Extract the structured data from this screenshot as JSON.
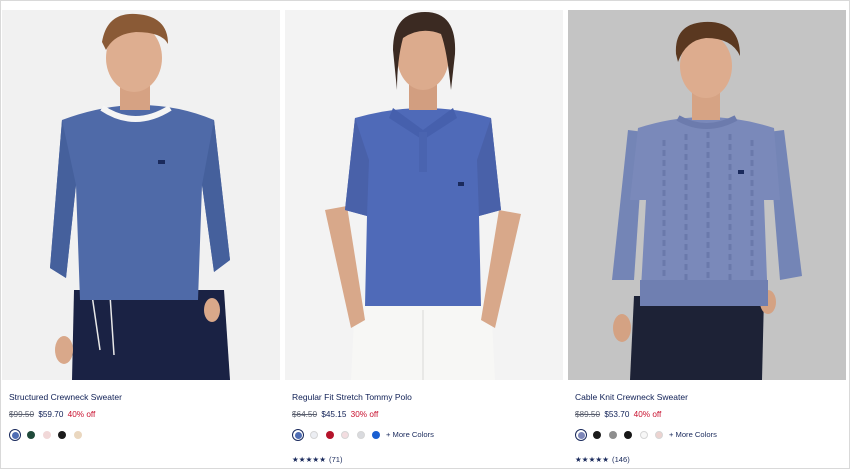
{
  "products": [
    {
      "title": "Structured Crewneck Sweater",
      "original_price": "$99.50",
      "sale_price": "$59.70",
      "discount": "40% off",
      "swatches": [
        "#4f6db3",
        "#1f4a3a",
        "#f1d8d8",
        "#1b1b1b",
        "#ead7bf"
      ],
      "more_colors": "",
      "rating_stars": "",
      "rating_count": ""
    },
    {
      "title": "Regular Fit Stretch Tommy Polo",
      "original_price": "$64.50",
      "sale_price": "$45.15",
      "discount": "30% off",
      "swatches": [
        "#4f6db3",
        "#eceef3",
        "#b5132a",
        "#f3dde0",
        "#d9dade",
        "#1a5fd1"
      ],
      "more_colors": "+ More Colors",
      "rating_stars": "★★★★★",
      "rating_count": "(71)"
    },
    {
      "title": "Cable Knit Crewneck Sweater",
      "original_price": "$89.50",
      "sale_price": "$53.70",
      "discount": "40% off",
      "swatches": [
        "#7d86b8",
        "#1b1b1b",
        "#8e8e8e",
        "#161616",
        "#f7f7f7",
        "#ecd3d0"
      ],
      "more_colors": "+ More Colors",
      "rating_stars": "★★★★★",
      "rating_count": "(146)"
    }
  ],
  "colors": {
    "navy_text": "#0f1f55",
    "sale_red": "#c8102e",
    "strike_grey": "#5a5f6e"
  }
}
